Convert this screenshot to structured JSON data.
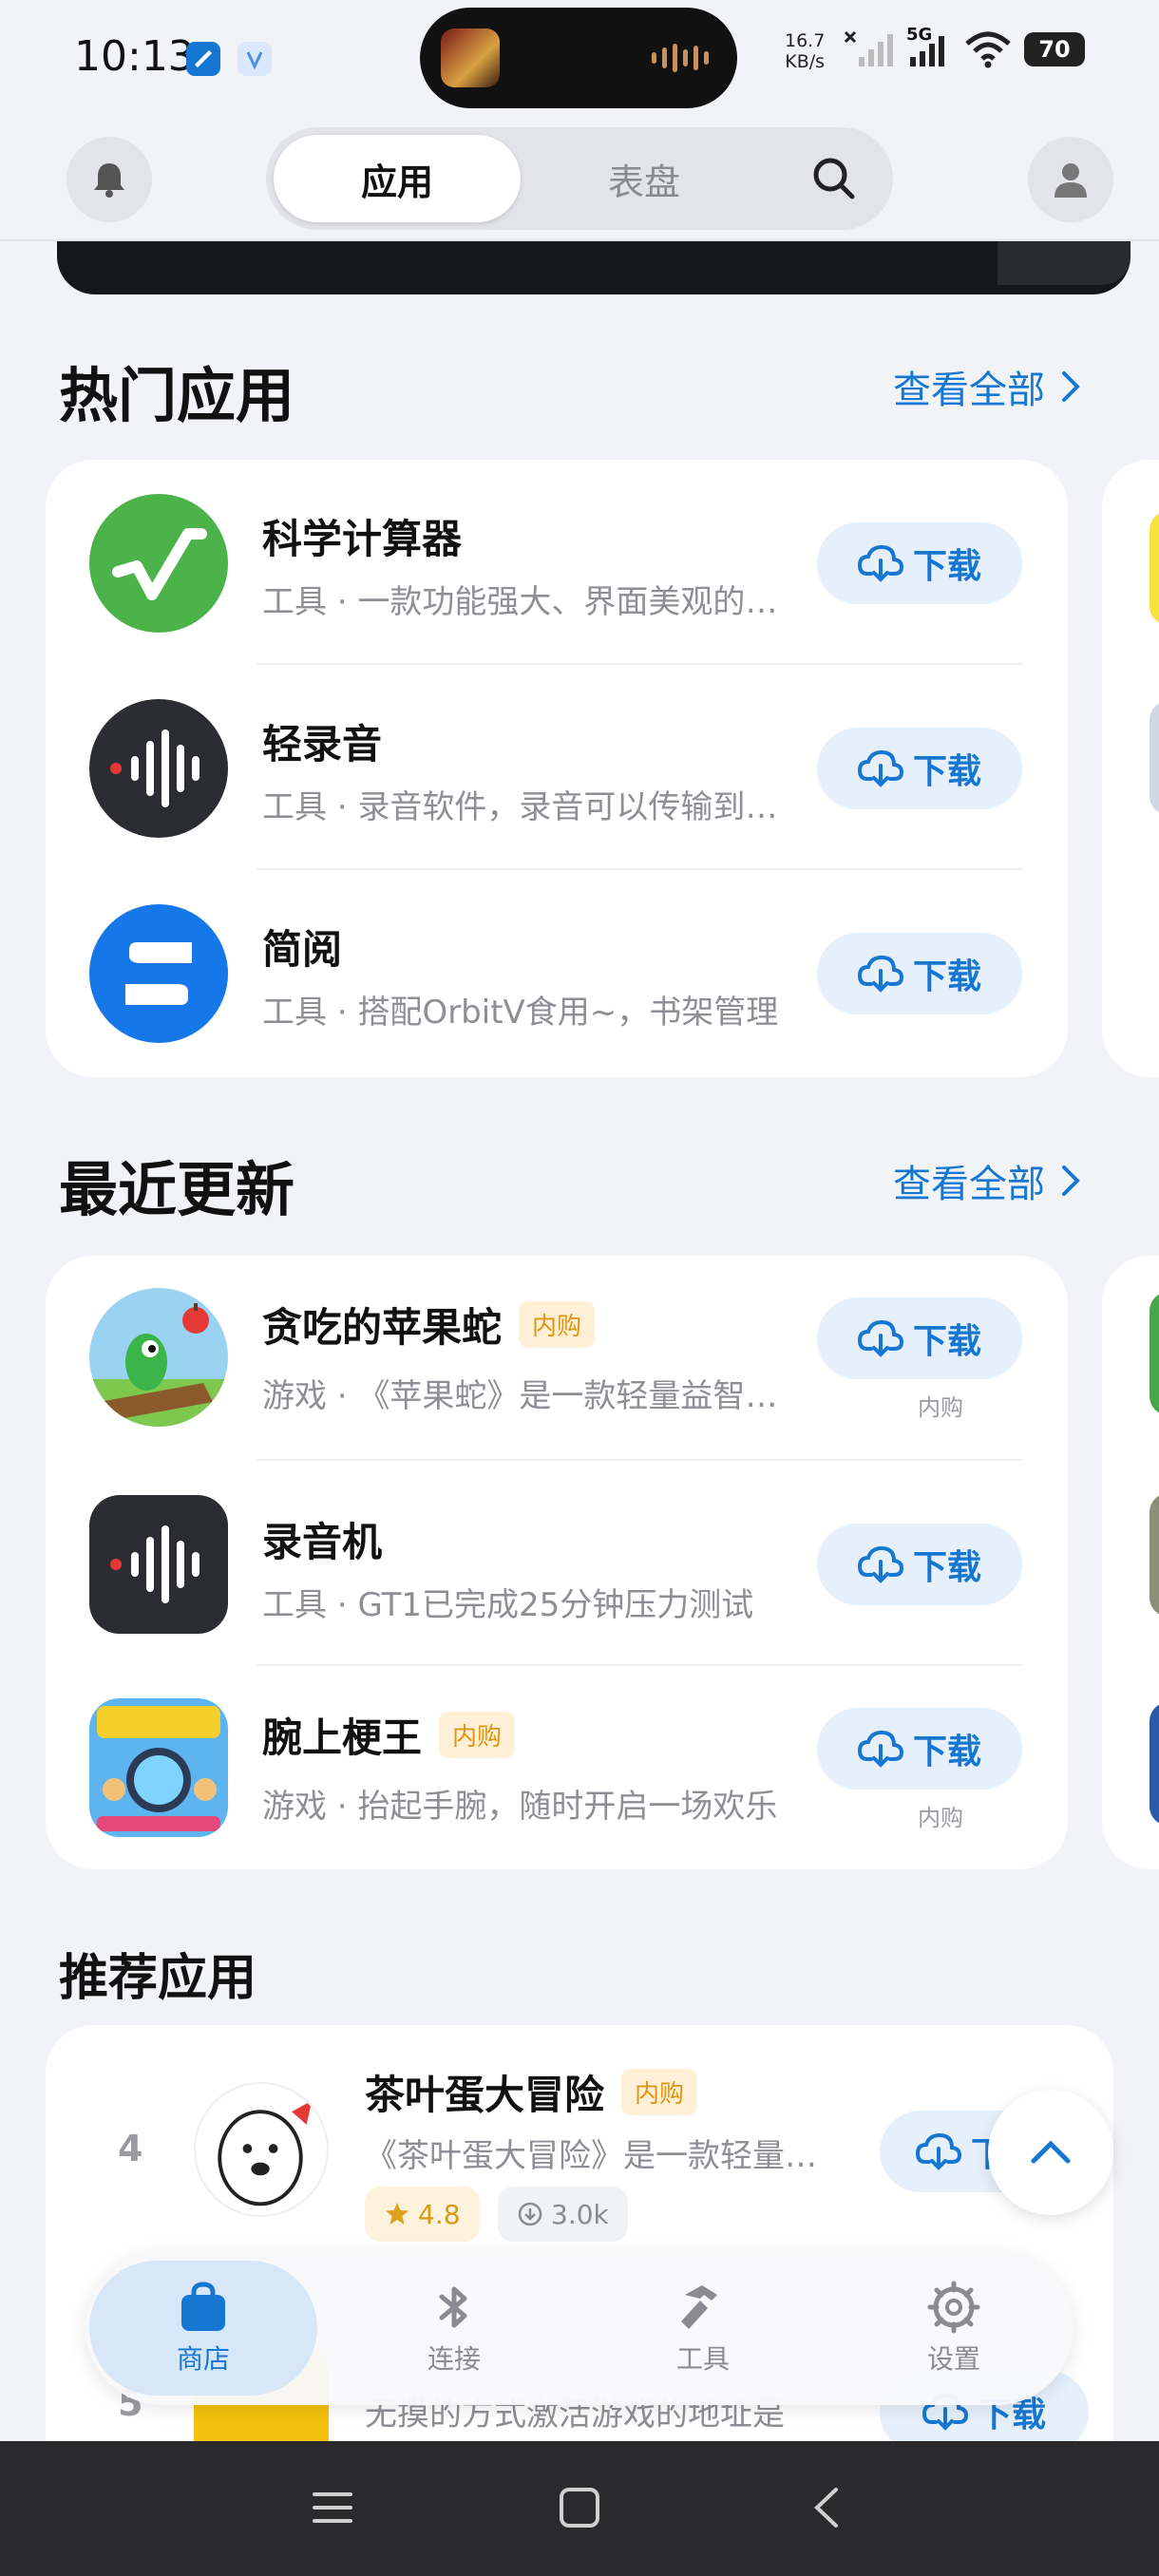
{
  "status_bar": {
    "time": "10:13",
    "net_speed_value": "16.7",
    "net_speed_unit": "KB/s",
    "network_type": "5G",
    "battery": "70"
  },
  "header": {
    "tabs": [
      {
        "label": "应用",
        "active": true
      },
      {
        "label": "表盘",
        "active": false
      }
    ]
  },
  "sections": {
    "hot": {
      "title": "热门应用",
      "view_all": "查看全部",
      "apps": [
        {
          "name": "科学计算器",
          "category": "工具",
          "desc": "一款功能强大、界面美观的科学计算器",
          "button": "下载",
          "icon": "sqrt-icon"
        },
        {
          "name": "轻录音",
          "category": "工具",
          "desc": "录音软件，录音可以传输到手机",
          "button": "下载",
          "icon": "waveform-icon"
        },
        {
          "name": "简阅",
          "category": "工具",
          "desc": "搭配OrbitV食用~，书架管理",
          "button": "下载",
          "icon": "book-s-icon"
        }
      ]
    },
    "recent": {
      "title": "最近更新",
      "view_all": "查看全部",
      "apps": [
        {
          "name": "贪吃的苹果蛇",
          "badge": "内购",
          "category": "游戏",
          "desc": "《苹果蛇》是一款轻量益智游戏",
          "button": "下载",
          "sub": "内购",
          "icon": "apple-snake-icon"
        },
        {
          "name": "录音机",
          "badge": "",
          "category": "工具",
          "desc": "GT1已完成25分钟压力测试",
          "button": "下载",
          "sub": "",
          "icon": "waveform-icon"
        },
        {
          "name": "腕上梗王",
          "badge": "内购",
          "category": "游戏",
          "desc": "抬起手腕，随时开启一场欢乐",
          "button": "下载",
          "sub": "内购",
          "icon": "meme-king-icon"
        }
      ]
    },
    "recommended": {
      "title": "推荐应用",
      "items": [
        {
          "rank": "4",
          "name": "茶叶蛋大冒险",
          "badge": "内购",
          "desc": "《茶叶蛋大冒险》是一款轻量级游戏",
          "rating": "4.8",
          "downloads": "3.0k",
          "button": "下载"
        },
        {
          "rank": "5",
          "name": "",
          "desc": "无摸的方式激活游戏的地址是",
          "button": "下载"
        }
      ]
    }
  },
  "tabbar": {
    "tabs": [
      {
        "label": "商店",
        "icon": "bag-icon",
        "active": true
      },
      {
        "label": "连接",
        "icon": "bluetooth-icon",
        "active": false
      },
      {
        "label": "工具",
        "icon": "hammer-icon",
        "active": false
      },
      {
        "label": "设置",
        "icon": "gear-icon",
        "active": false
      }
    ]
  },
  "colors": {
    "accent": "#1677d2",
    "background": "#f2f3f7",
    "iap_badge_text": "#e09510"
  }
}
